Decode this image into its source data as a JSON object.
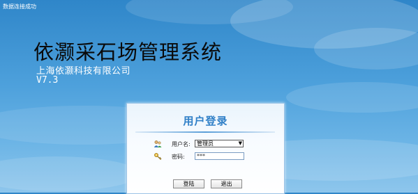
{
  "status": {
    "text": "数据连接成功"
  },
  "app": {
    "title": "依灏采石场管理系统",
    "company": "上海依灏科技有限公司",
    "version": "V7.3"
  },
  "login": {
    "title": "用户登录",
    "username_label": "用户名:",
    "username_value": "管理员",
    "password_label": "密码:",
    "password_value": "***",
    "login_button": "登陆",
    "exit_button": "退出"
  },
  "icons": {
    "user": "user-icon",
    "key": "key-icon",
    "dropdown": "chevron-down-icon"
  },
  "colors": {
    "background_top": "#2f86c9",
    "background_bottom": "#8ec6ec",
    "login_title": "#2f7fc7",
    "panel_border": "#9cc3e6"
  }
}
